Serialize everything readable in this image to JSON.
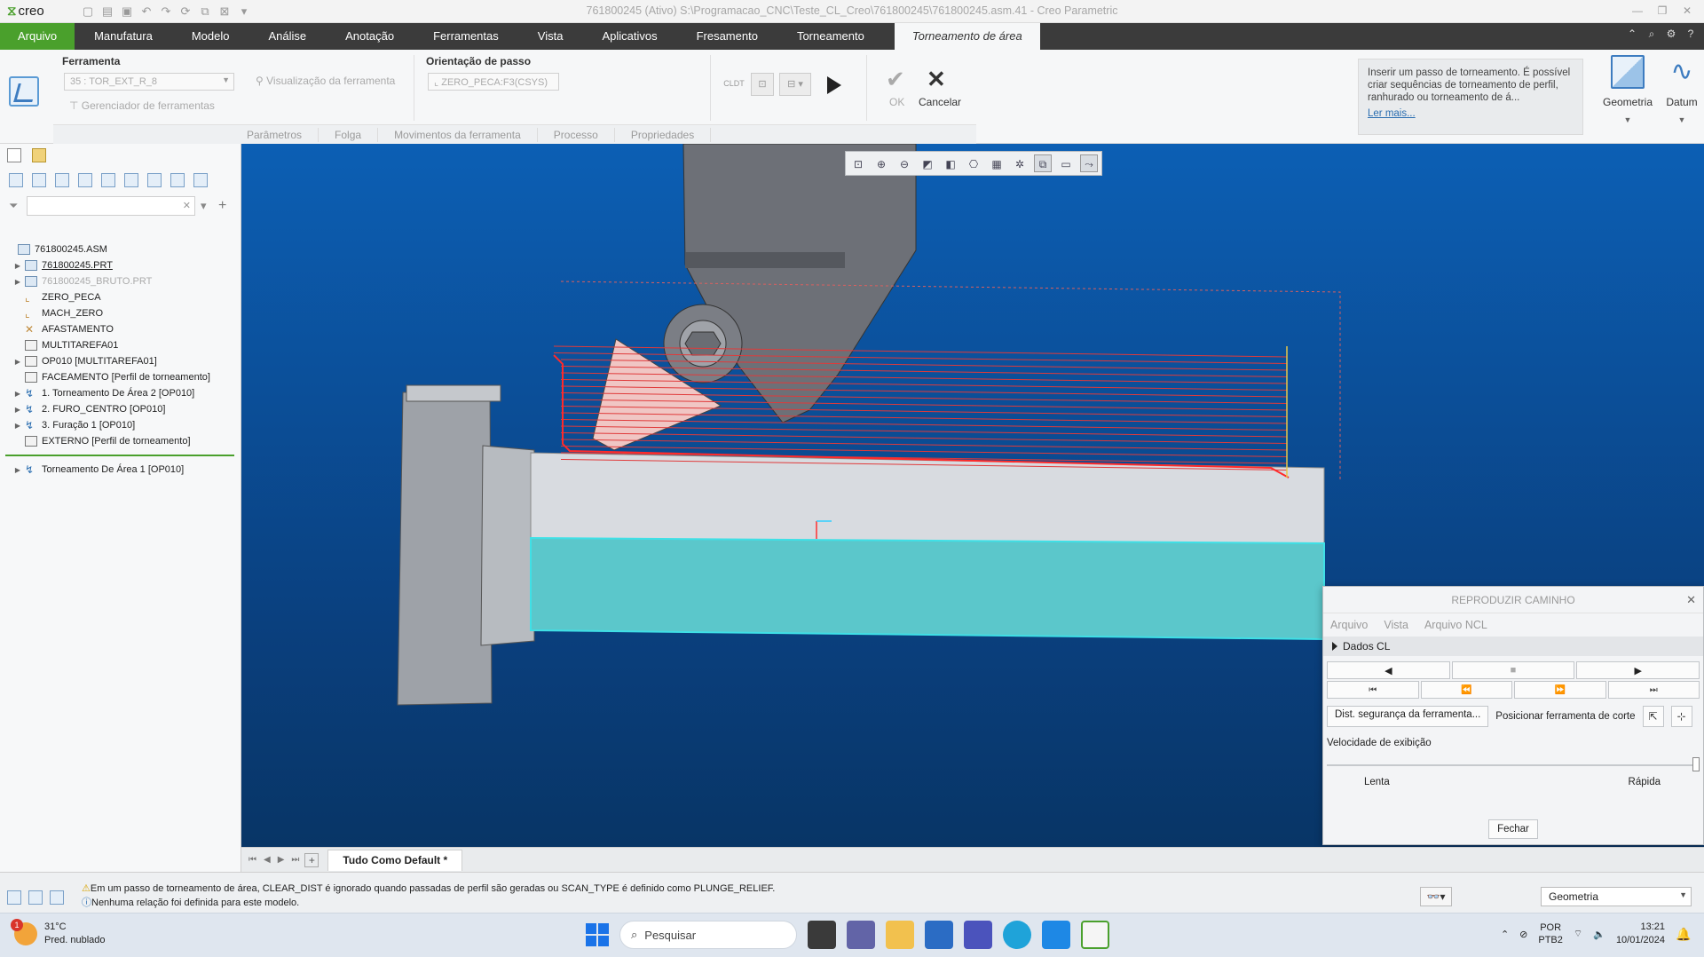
{
  "app": {
    "logo": "creo",
    "window_title": "761800245 (Ativo) S:\\Programacao_CNC\\Teste_CL_Creo\\761800245\\761800245.asm.41 - Creo Parametric"
  },
  "menu": {
    "tabs": [
      "Arquivo",
      "Manufatura",
      "Modelo",
      "Análise",
      "Anotação",
      "Ferramentas",
      "Vista",
      "Aplicativos",
      "Fresamento",
      "Torneamento"
    ],
    "active_tab": "Torneamento de área",
    "colors": {
      "file_tab": "#4aa02c",
      "menubar": "#3b3b3b"
    }
  },
  "ribbon": {
    "ferramenta_label": "Ferramenta",
    "tool_select": "35 : TOR_EXT_R_8",
    "tool_preview": "Visualização da ferramenta",
    "tool_manager": "Gerenciador de ferramentas",
    "orientacao_label": "Orientação de passo",
    "csys_select": "ZERO_PECA:F3(CSYS)",
    "cldt_label": "CLDT",
    "ok_label": "OK",
    "cancel_label": "Cancelar",
    "groups": [
      "Parâmetros",
      "Folga",
      "Movimentos da ferramenta",
      "Processo",
      "Propriedades"
    ],
    "info_text": "Inserir um passo de torneamento. É possível criar sequências de torneamento de perfil, ranhurado ou torneamento de á...",
    "info_link": "Ler mais...",
    "geometria_label": "Geometria",
    "datum_label": "Datum"
  },
  "tree": {
    "items": [
      {
        "label": "761800245.ASM",
        "indent": 0,
        "expander": "",
        "icon": "assembly-icon",
        "style": ""
      },
      {
        "label": "761800245.PRT",
        "indent": 1,
        "expander": "▶",
        "icon": "part-icon",
        "style": "underline"
      },
      {
        "label": "761800245_BRUTO.PRT",
        "indent": 1,
        "expander": "▶",
        "icon": "part-icon",
        "style": "grey"
      },
      {
        "label": "ZERO_PECA",
        "indent": 1,
        "expander": "",
        "icon": "csys-icon",
        "style": ""
      },
      {
        "label": "MACH_ZERO",
        "indent": 1,
        "expander": "",
        "icon": "csys-icon",
        "style": ""
      },
      {
        "label": "AFASTAMENTO",
        "indent": 1,
        "expander": "",
        "icon": "retract-icon",
        "style": ""
      },
      {
        "label": "MULTITAREFA01",
        "indent": 1,
        "expander": "",
        "icon": "machine-icon",
        "style": ""
      },
      {
        "label": "OP010 [MULTITAREFA01]",
        "indent": 1,
        "expander": "▶",
        "icon": "operation-icon",
        "style": ""
      },
      {
        "label": "FACEAMENTO [Perfil de torneamento]",
        "indent": 1,
        "expander": "",
        "icon": "profile-icon",
        "style": ""
      },
      {
        "label": "1. Torneamento De Área 2 [OP010]",
        "indent": 1,
        "expander": "▶",
        "icon": "sequence-icon",
        "style": ""
      },
      {
        "label": "2. FURO_CENTRO [OP010]",
        "indent": 1,
        "expander": "▶",
        "icon": "sequence-icon",
        "style": ""
      },
      {
        "label": "3. Furação 1 [OP010]",
        "indent": 1,
        "expander": "▶",
        "icon": "sequence-icon",
        "style": ""
      },
      {
        "label": "EXTERNO [Perfil de torneamento]",
        "indent": 1,
        "expander": "",
        "icon": "profile-icon",
        "style": ""
      }
    ],
    "insert_item": "Torneamento De Área 1 [OP010]"
  },
  "viewport": {
    "tab": "Tudo Como Default *"
  },
  "dialog": {
    "title": "REPRODUZIR CAMINHO",
    "menu": [
      "Arquivo",
      "Vista",
      "Arquivo NCL"
    ],
    "section": "Dados CL",
    "dist_button": "Dist. segurança da ferramenta...",
    "position_label": "Posicionar ferramenta de corte",
    "speed_label": "Velocidade de exibição",
    "speed_slow": "Lenta",
    "speed_fast": "Rápida",
    "speed_value": 1.0,
    "close_button": "Fechar"
  },
  "status": {
    "message1": "Em um passo de torneamento de área, CLEAR_DIST é ignorado quando passadas de perfil são geradas ou SCAN_TYPE é definido como PLUNGE_RELIEF.",
    "message2": "Nenhuma relação foi definida para este modelo.",
    "filter": "Geometria"
  },
  "taskbar": {
    "weather_badge": "1",
    "temperature": "31°C",
    "weather": "Pred. nublado",
    "search_placeholder": "Pesquisar",
    "lang1": "POR",
    "lang2": "PTB2",
    "time": "13:21",
    "date": "10/01/2024"
  }
}
